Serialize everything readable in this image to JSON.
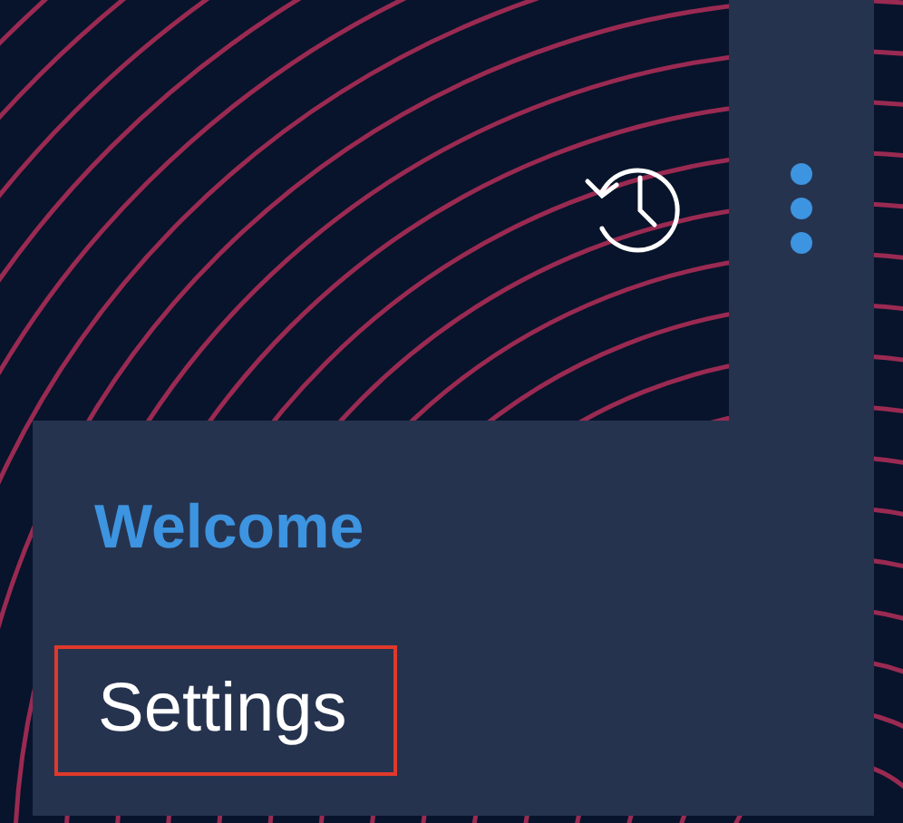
{
  "menu": [
    {
      "label": "Welcome",
      "selected": true,
      "highlighted": false
    },
    {
      "label": "Settings",
      "selected": false,
      "highlighted": true
    }
  ]
}
